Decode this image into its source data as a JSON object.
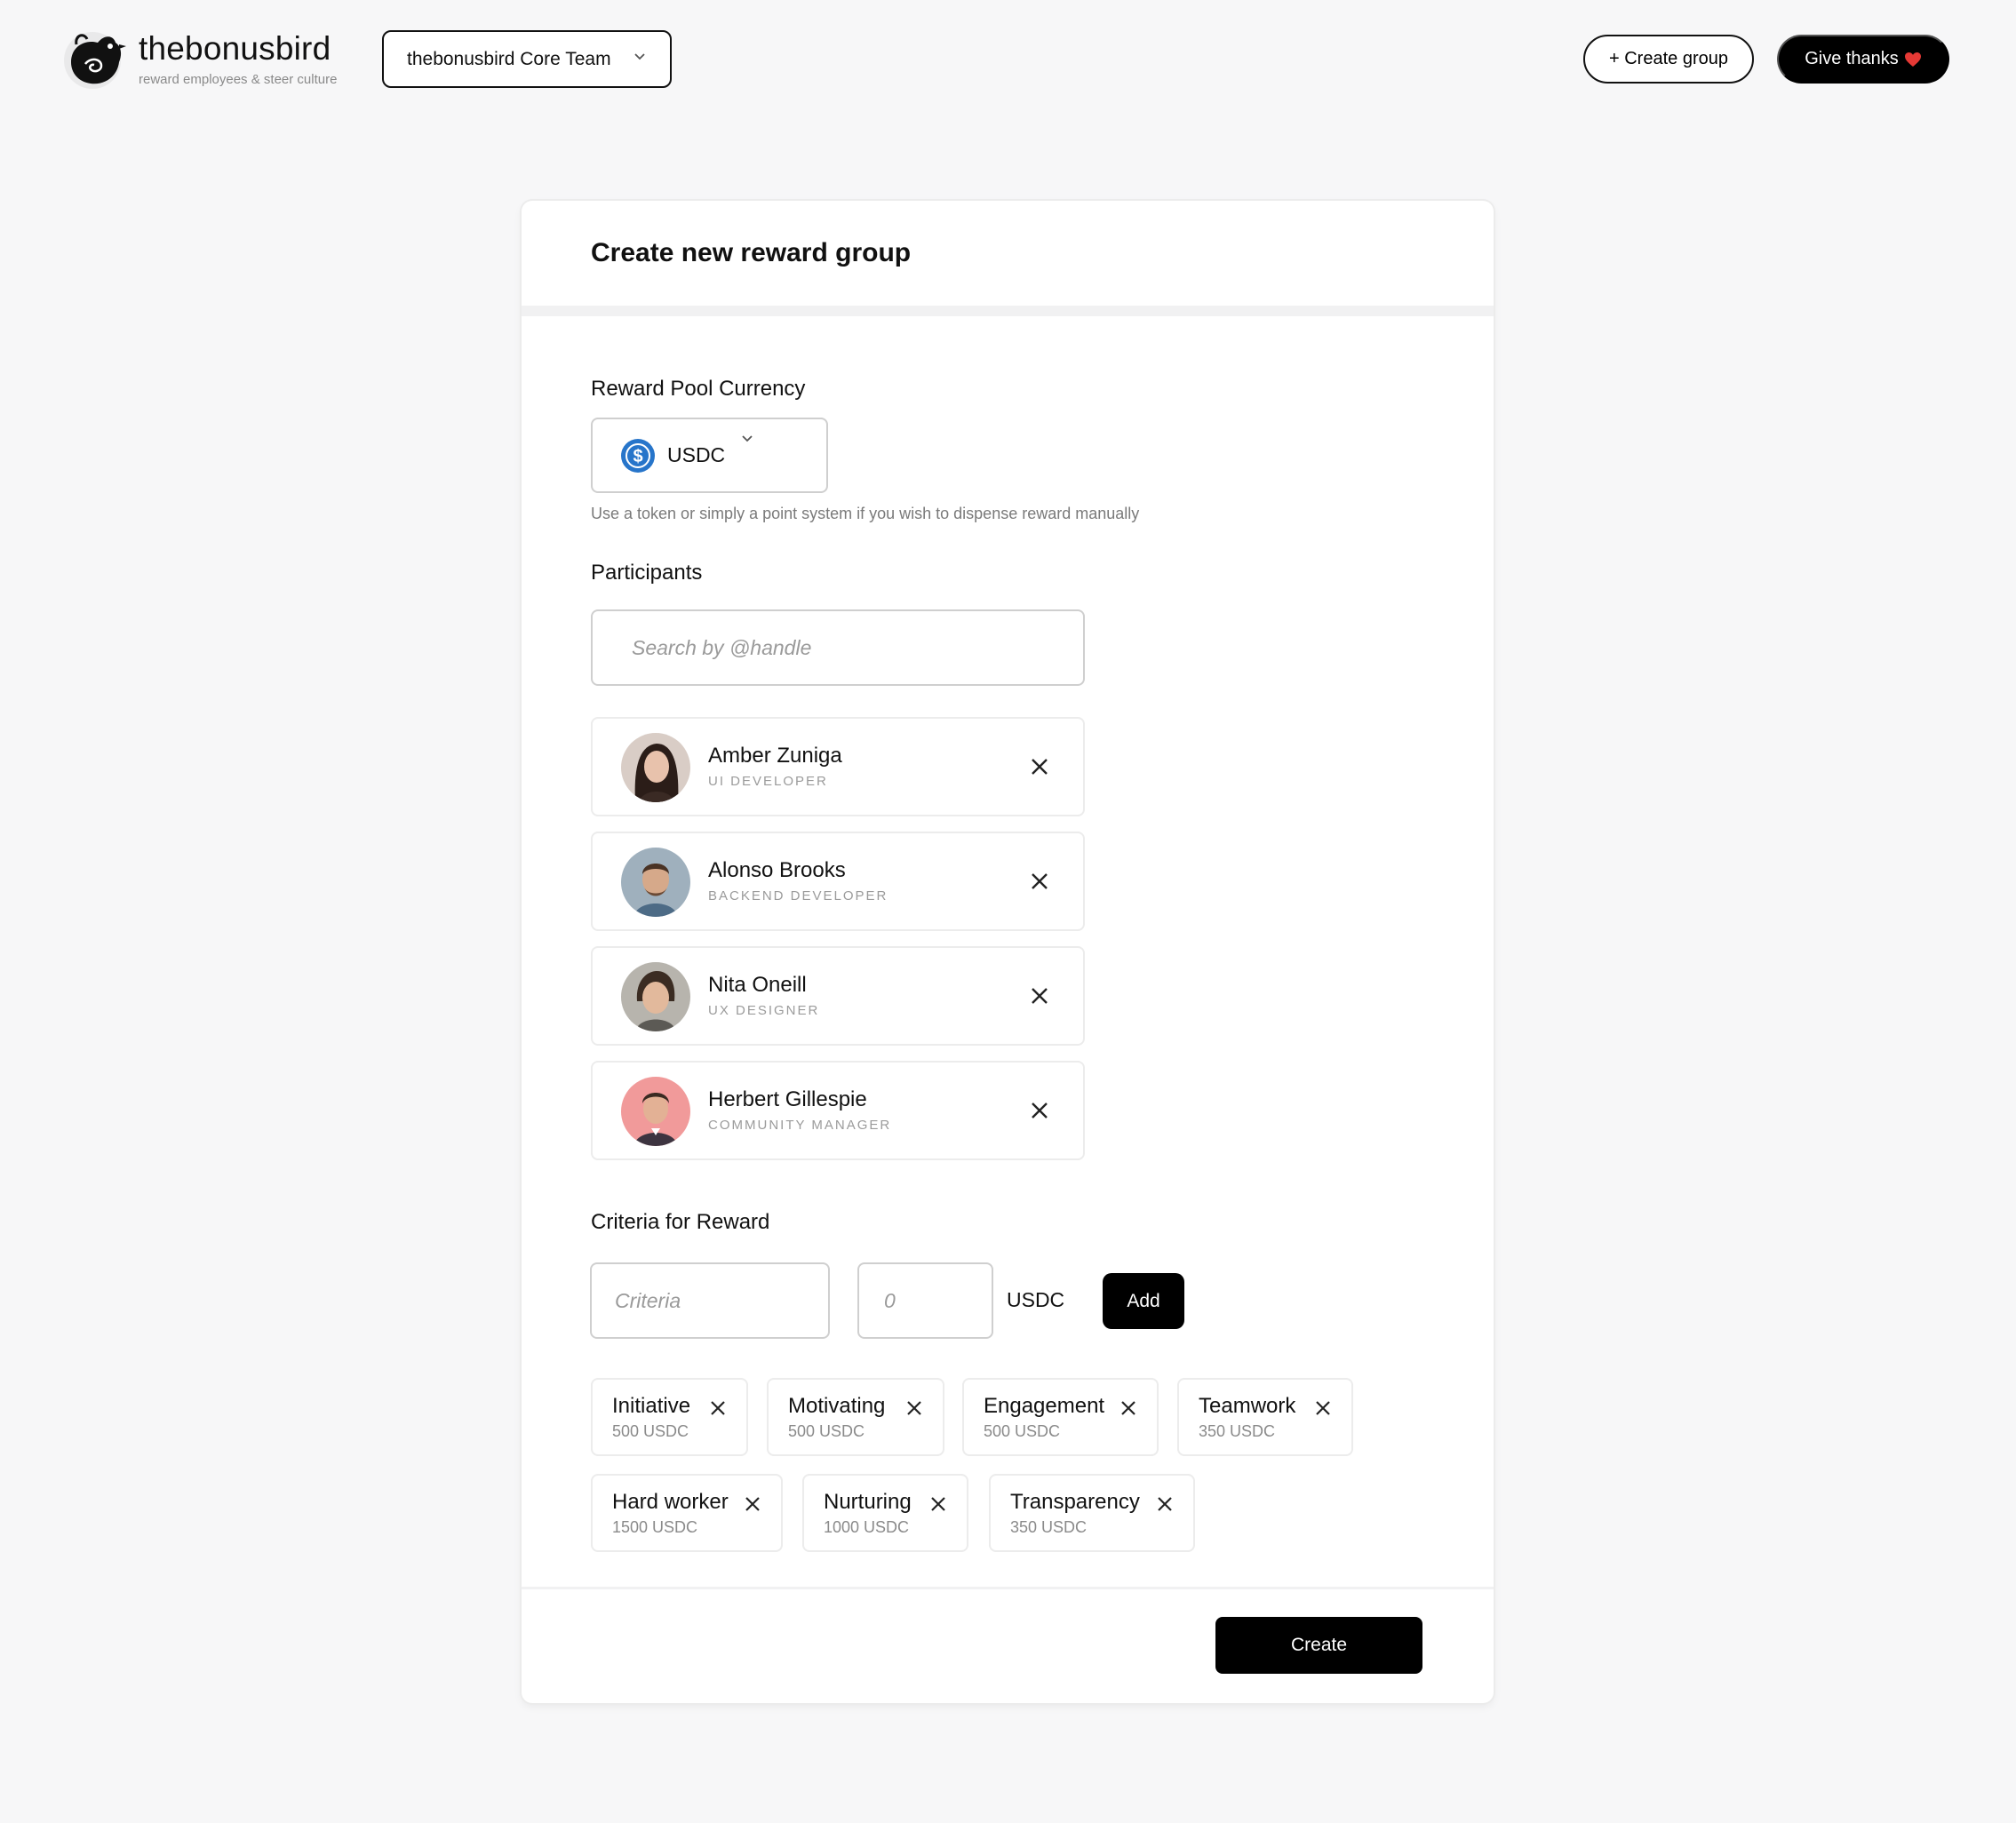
{
  "brand": {
    "name": "thebonusbird",
    "tagline": "reward employees & steer culture"
  },
  "header": {
    "team_select": "thebonusbird Core Team",
    "create_group_label": "+ Create group",
    "give_thanks_label": "Give thanks",
    "give_thanks_emoji": "❤️"
  },
  "form": {
    "title": "Create new reward group",
    "currency_label": "Reward Pool Currency",
    "currency_value": "USDC",
    "currency_hint": "Use a token or simply a point system if you wish to dispense reward manually",
    "participants_label": "Participants",
    "search_placeholder": "Search by @handle",
    "participants": [
      {
        "name": "Amber Zuniga",
        "role": "UI DEVELOPER"
      },
      {
        "name": "Alonso Brooks",
        "role": "BACKEND DEVELOPER"
      },
      {
        "name": "Nita Oneill",
        "role": "UX DESIGNER"
      },
      {
        "name": "Herbert Gillespie",
        "role": "COMMUNITY MANAGER"
      }
    ],
    "criteria_label": "Criteria for Reward",
    "criteria_placeholder": "Criteria",
    "amount_placeholder": "0",
    "amount_unit": "USDC",
    "add_label": "Add",
    "criteria": [
      {
        "name": "Initiative",
        "amount": "500 USDC"
      },
      {
        "name": "Motivating",
        "amount": "500 USDC"
      },
      {
        "name": "Engagement",
        "amount": "500 USDC"
      },
      {
        "name": "Teamwork",
        "amount": "350 USDC"
      },
      {
        "name": "Hard worker",
        "amount": "1500 USDC"
      },
      {
        "name": "Nurturing",
        "amount": "1000 USDC"
      },
      {
        "name": "Transparency",
        "amount": "350 USDC"
      }
    ],
    "create_label": "Create"
  },
  "colors": {
    "background": "#f7f7f8",
    "primary": "#000000",
    "usdc_blue": "#2775ca",
    "heart": "#e53935"
  }
}
